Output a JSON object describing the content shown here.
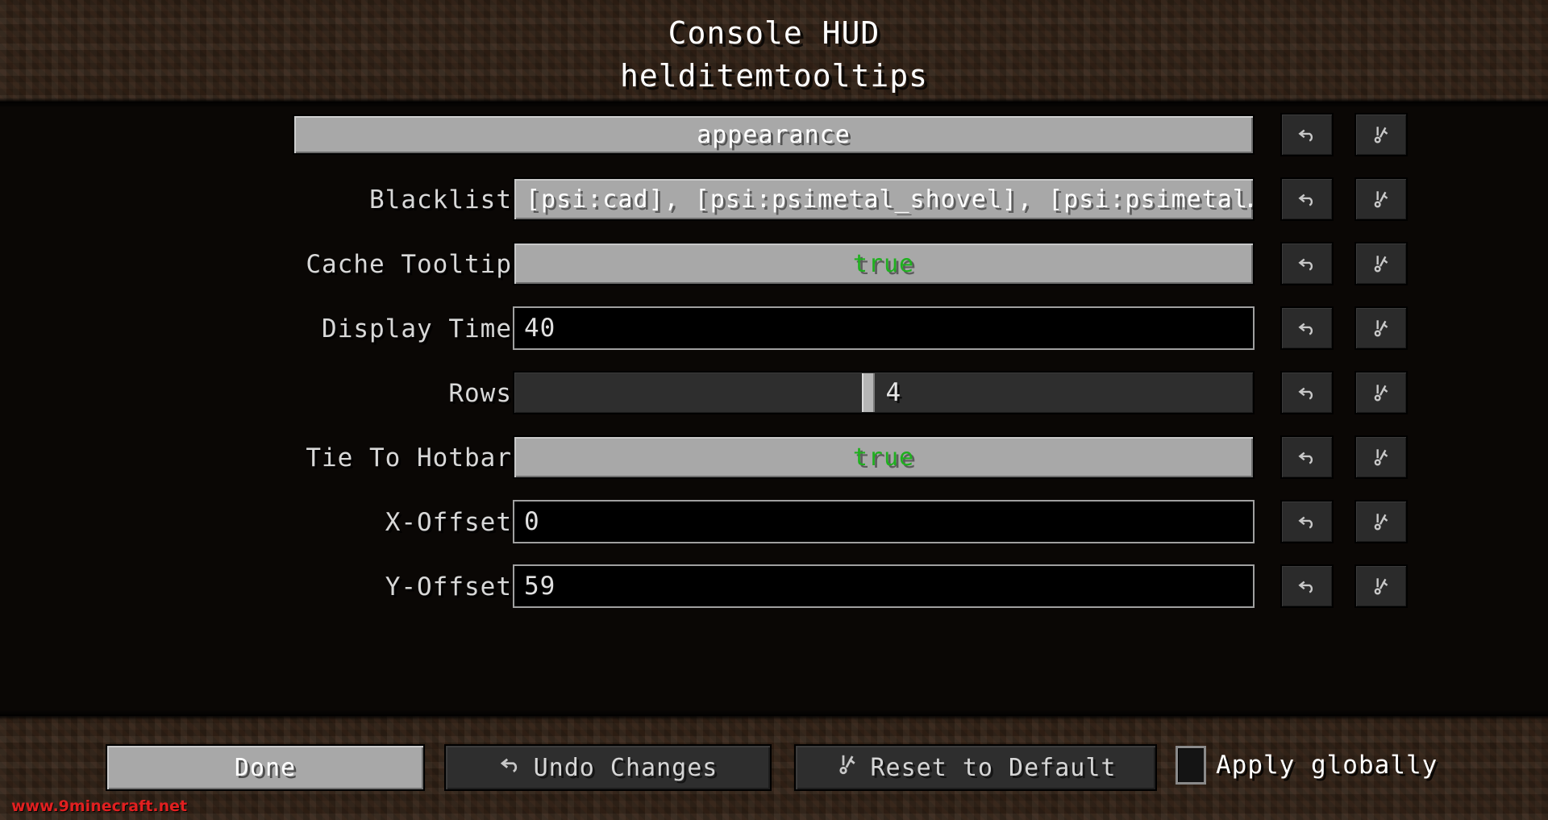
{
  "header": {
    "title": "Console HUD",
    "subtitle": "helditemtooltips"
  },
  "category": {
    "label": "appearance"
  },
  "entries": [
    {
      "label": "Blacklist",
      "type": "string",
      "value": "[psi:cad], [psi:psimetal_shovel], [psi:psimetal…"
    },
    {
      "label": "Cache Tooltip",
      "type": "boolean",
      "value": "true"
    },
    {
      "label": "Display Time",
      "type": "number",
      "value": "40"
    },
    {
      "label": "Rows",
      "type": "slider",
      "value": "4",
      "handle_percent": 47
    },
    {
      "label": "Tie To Hotbar",
      "type": "boolean",
      "value": "true"
    },
    {
      "label": "X-Offset",
      "type": "number",
      "value": "0"
    },
    {
      "label": "Y-Offset",
      "type": "number",
      "value": "59"
    }
  ],
  "row_actions": {
    "undo_icon": "undo-arrow-icon",
    "reset_icon": "reset-to-default-icon"
  },
  "footer": {
    "done_label": "Done",
    "undo_label": "Undo Changes",
    "reset_label": "Reset to Default",
    "apply_globally_label": "Apply globally",
    "apply_globally_checked": false
  },
  "watermark": {
    "text": "www.9minecraft.net"
  },
  "colors": {
    "true_green": "#1fb01f",
    "button_gray": "#a8a8a8",
    "dark_button": "#2e2e2e",
    "watermark_red": "#e02020",
    "dirt_brown": "#3a2a1d"
  }
}
